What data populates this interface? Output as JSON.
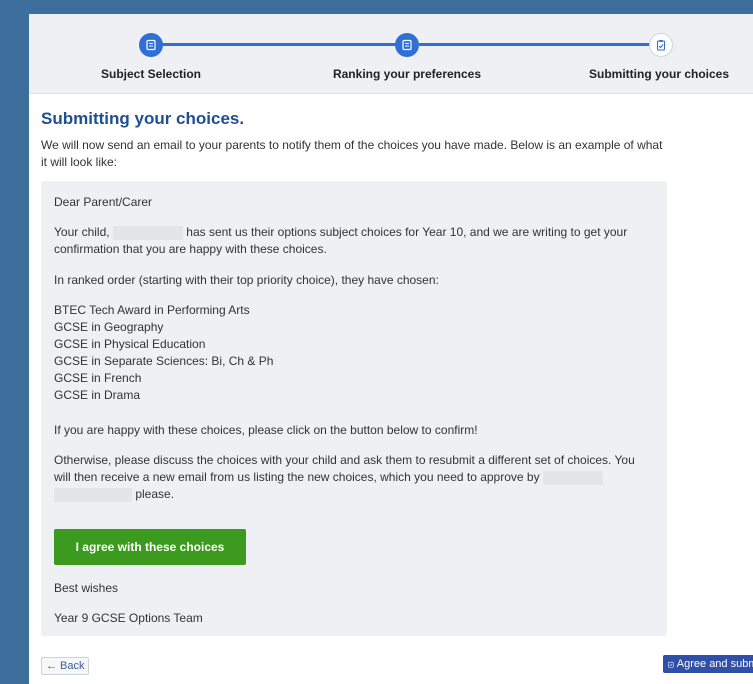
{
  "stepper": {
    "steps": [
      {
        "label": "Subject Selection",
        "state": "done",
        "icon": "list-icon"
      },
      {
        "label": "Ranking your preferences",
        "state": "done",
        "icon": "list-icon"
      },
      {
        "label": "Submitting your choices",
        "state": "current",
        "icon": "clipboard-check-icon"
      }
    ]
  },
  "page": {
    "title": "Submitting your choices.",
    "intro": "We will now send an email to your parents to notify them of the choices you have made. Below is an example of what it will look like:"
  },
  "email": {
    "greeting": "Dear Parent/Carer",
    "para1_start": "Your child,",
    "para1_end": "has sent us their options subject choices for Year 10, and we are writing to get your confirmation that you are happy with these choices.",
    "ranked_intro": "In ranked order (starting with their top priority choice), they have chosen:",
    "choices": [
      "BTEC Tech Award in Performing Arts",
      "GCSE in Geography",
      "GCSE in Physical Education",
      "GCSE in Separate Sciences: Bi, Ch & Ph",
      "GCSE in French",
      "GCSE in Drama"
    ],
    "confirm_text": "If you are happy with these choices, please click on the button below to confirm!",
    "otherwise_text": "Otherwise, please discuss the choices with your child and ask them to resubmit a different set of choices. You will then receive a new email from us listing the new choices, which you need to approve by",
    "otherwise_end": "please.",
    "agree_label": "I agree with these choices",
    "signoff": "Best wishes",
    "team": "Year 9 GCSE Options Team"
  },
  "footer": {
    "back_label": "Back",
    "submit_label": "Agree and submit"
  },
  "colors": {
    "background": "#3e6f9c",
    "accent": "#2f6fd6",
    "title": "#1f4e93",
    "agree_button": "#3c9a1e",
    "submit_button": "#2f4fa8"
  }
}
